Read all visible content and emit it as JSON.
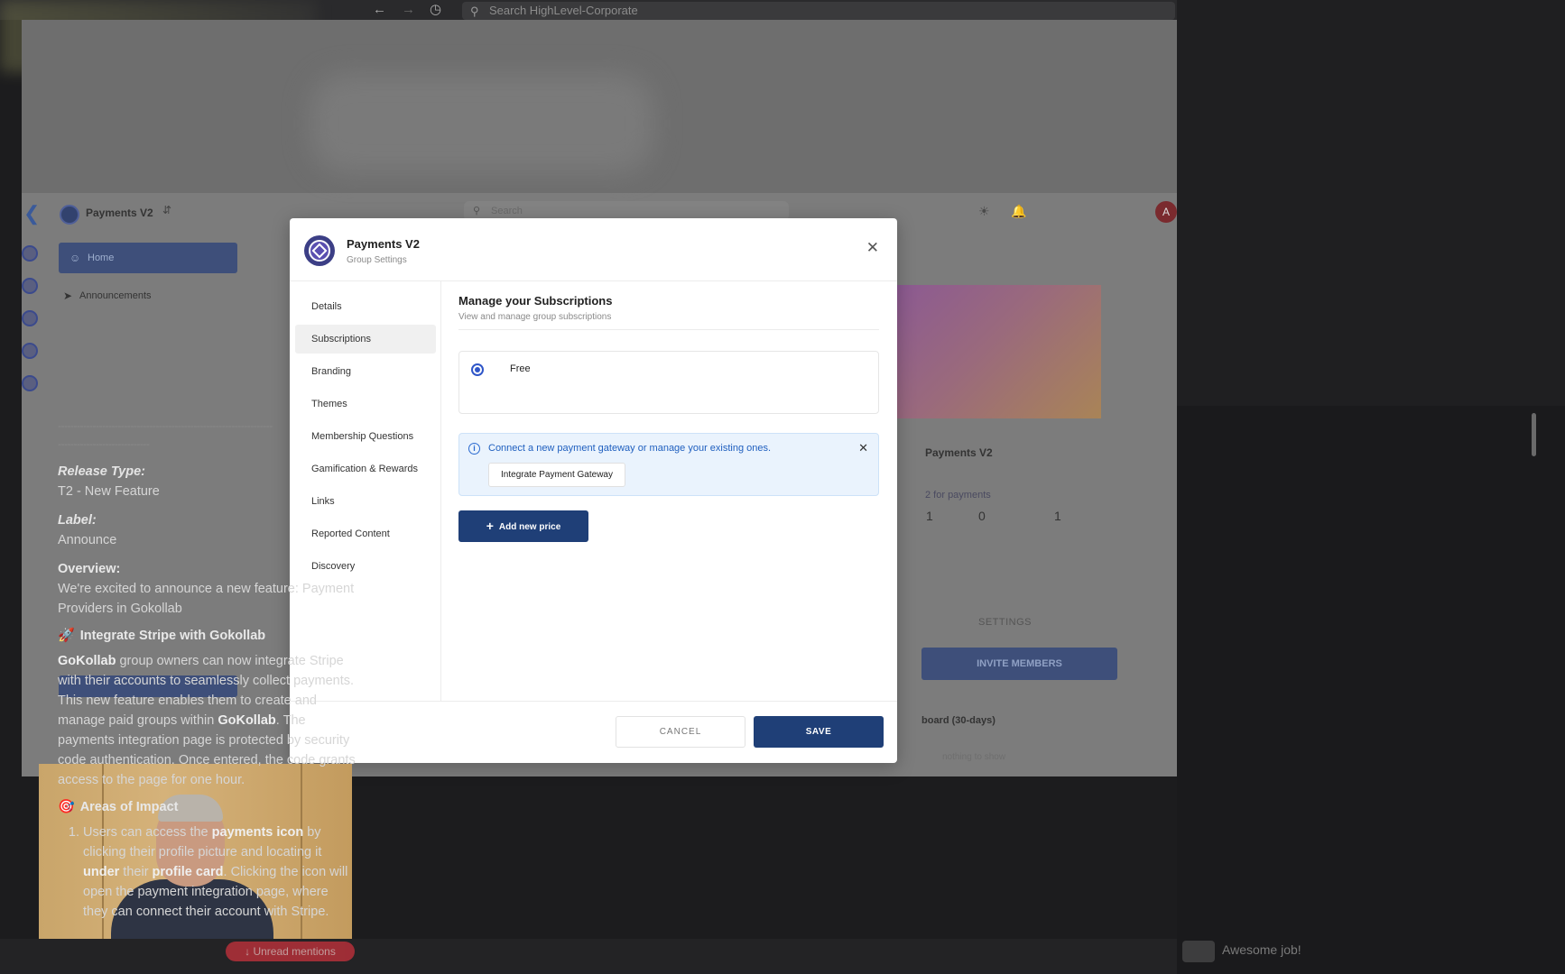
{
  "browser": {
    "search_placeholder": "Search HighLevel-Corporate"
  },
  "background_app": {
    "group_name": "Payments V2",
    "search_placeholder": "Search",
    "avatar_initial": "A",
    "nav": {
      "home": "Home",
      "announcements": "Announcements"
    },
    "group_title": "Payments V2",
    "payments_hint": "2 for payments",
    "stats": [
      "1",
      "0",
      "1"
    ],
    "settings_tab": "SETTINGS",
    "invite_button": "INVITE MEMBERS",
    "leaderboard": "board (30-days)",
    "empty_text": "nothing to show"
  },
  "modal": {
    "title": "Payments V2",
    "subtitle": "Group Settings",
    "sidebar": [
      {
        "label": "Details",
        "active": false
      },
      {
        "label": "Subscriptions",
        "active": true
      },
      {
        "label": "Branding",
        "active": false
      },
      {
        "label": "Themes",
        "active": false
      },
      {
        "label": "Membership Questions",
        "active": false
      },
      {
        "label": "Gamification & Rewards",
        "active": false
      },
      {
        "label": "Links",
        "active": false
      },
      {
        "label": "Reported Content",
        "active": false
      },
      {
        "label": "Discovery",
        "active": false
      }
    ],
    "section_title": "Manage your Subscriptions",
    "section_subtitle": "View and manage group subscriptions",
    "price_option": "Free",
    "info_text": "Connect a new payment gateway or manage your existing ones.",
    "gateway_button": "Integrate Payment Gateway",
    "add_price_button": "Add new price",
    "cancel_button": "CANCEL",
    "save_button": "SAVE"
  },
  "bottom": {
    "unread_mentions": "Unread mentions"
  },
  "doc": {
    "release_type_label": "Release Type:",
    "release_type_value": "T2 - New Feature",
    "label_label": "Label:",
    "label_value": "Announce",
    "overview_label": "Overview:",
    "overview_text": "We're excited to announce a new feature: Payment Providers in Gokollab",
    "heading1": "Integrate Stripe with Gokollab",
    "para1_b1": "GoKollab",
    "para1_t1": " group owners can now integrate Stripe with their accounts to seamlessly collect payments. This new feature enables them to create and manage paid groups within ",
    "para1_b2": "GoKollab",
    "para1_t2": ". The payments integration page is protected by security code authentication. Once entered, the code grants access to the page for one hour.",
    "heading2": "Areas of Impact",
    "li1_t1": "Users can access the ",
    "li1_b1": "payments icon",
    "li1_t2": " by clicking their profile picture and locating it ",
    "li1_b2": "under",
    "li1_t3": " their ",
    "li1_b3": "profile card",
    "li1_t4": ". Clicking the icon will open the payment integration page, where they can connect their account with Stripe.",
    "reply_text": "Awesome job!"
  },
  "colors": {
    "primary_button": "#1f3f77",
    "info_blue": "#1f5fbf",
    "radio_blue": "#2f56c8"
  }
}
